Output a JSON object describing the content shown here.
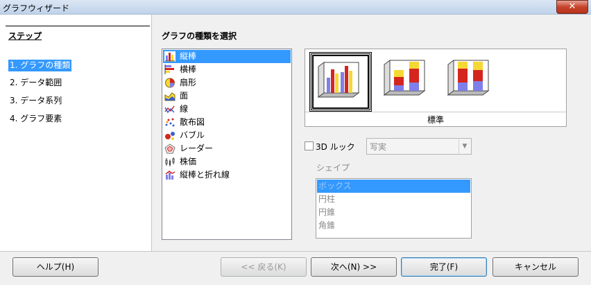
{
  "window": {
    "title": "グラフウィザード",
    "close_glyph": "✕"
  },
  "steps": {
    "heading": "ステップ",
    "items": [
      {
        "label": "1. グラフの種類"
      },
      {
        "label": "2. データ範囲"
      },
      {
        "label": "3. データ系列"
      },
      {
        "label": "4. グラフ要素"
      }
    ],
    "selected": "1. グラフの種類"
  },
  "main": {
    "heading": "グラフの種類を選択",
    "chart_types": [
      {
        "label": "縦棒",
        "icon": "column-chart-icon"
      },
      {
        "label": "横棒",
        "icon": "bar-chart-icon"
      },
      {
        "label": "扇形",
        "icon": "pie-chart-icon"
      },
      {
        "label": "面",
        "icon": "area-chart-icon"
      },
      {
        "label": "線",
        "icon": "line-chart-icon"
      },
      {
        "label": "散布図",
        "icon": "scatter-chart-icon"
      },
      {
        "label": "バブル",
        "icon": "bubble-chart-icon"
      },
      {
        "label": "レーダー",
        "icon": "radar-chart-icon"
      },
      {
        "label": "株価",
        "icon": "stock-chart-icon"
      },
      {
        "label": "縦棒と折れ線",
        "icon": "column-line-chart-icon"
      }
    ],
    "selected_type": "縦棒",
    "variant_caption": "標準",
    "variants": [
      "normal-column-icon",
      "stacked-column-icon",
      "percent-stacked-column-icon"
    ],
    "look3d": {
      "label": "3D ルック",
      "checked": false,
      "value": "写実"
    },
    "shape": {
      "label": "シェイプ",
      "options": [
        "ボックス",
        "円柱",
        "円錐",
        "角錐"
      ],
      "selected": "ボックス"
    }
  },
  "buttons": {
    "help": "ヘルプ(H)",
    "back": "<< 戻る(K)",
    "next": "次へ(N) >>",
    "finish": "完了(F)",
    "cancel": "キャンセル"
  },
  "colors": {
    "selection": "#3399ff",
    "bar_red": "#d4261f",
    "bar_yellow": "#f5d833",
    "bar_blue": "#7f7fea"
  }
}
